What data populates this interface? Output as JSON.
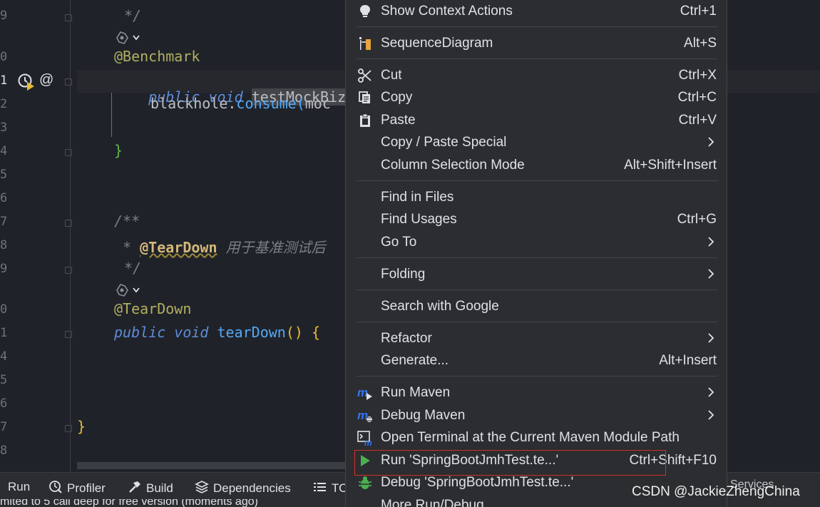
{
  "editor": {
    "line_numbers": [
      "9",
      "0",
      "1",
      "2",
      "3",
      "4",
      "5",
      "6",
      "7",
      "8",
      "9",
      "0",
      "1",
      "4",
      "5",
      "6",
      "7",
      "8"
    ],
    "code": {
      "comment_close_1": "*/",
      "ann_benchmark": "@Benchmark",
      "kw_public": "public",
      "kw_void": "void",
      "method_selected": "testMockBizSe",
      "blackhole": "blackhole.",
      "consume": "consume(",
      "moc": "moc",
      "close_brace_green": "}",
      "comment_open": "/**",
      "comment_star": " * ",
      "teardown_tag": "@TearDown",
      "teardown_desc": " 用于基准测试后",
      "comment_close_2": "*/",
      "ann_teardown": "@TearDown",
      "kw_public2": "public",
      "kw_void2": "void",
      "method_teardown": "tearDown",
      "parens": "() {",
      "class_close": "}"
    }
  },
  "context_menu": {
    "items": [
      {
        "label": "Show Context Actions",
        "shortcut": "Ctrl+1",
        "icon": "bulb-icon"
      },
      {
        "label": "SequenceDiagram",
        "shortcut": "Alt+S",
        "icon": "sequence-diagram-icon"
      },
      {
        "label": "Cut",
        "shortcut": "Ctrl+X",
        "icon": "scissors-icon"
      },
      {
        "label": "Copy",
        "shortcut": "Ctrl+C",
        "icon": "copy-icon"
      },
      {
        "label": "Paste",
        "shortcut": "Ctrl+V",
        "icon": "paste-icon"
      },
      {
        "label": "Copy / Paste Special",
        "shortcut": "",
        "icon": ""
      },
      {
        "label": "Column Selection Mode",
        "shortcut": "Alt+Shift+Insert",
        "icon": ""
      },
      {
        "label": "Find in Files",
        "shortcut": "",
        "icon": ""
      },
      {
        "label": "Find Usages",
        "shortcut": "Ctrl+G",
        "icon": ""
      },
      {
        "label": "Go To",
        "shortcut": "",
        "icon": ""
      },
      {
        "label": "Folding",
        "shortcut": "",
        "icon": ""
      },
      {
        "label": "Search with Google",
        "shortcut": "",
        "icon": ""
      },
      {
        "label": "Refactor",
        "shortcut": "",
        "icon": ""
      },
      {
        "label": "Generate...",
        "shortcut": "Alt+Insert",
        "icon": ""
      },
      {
        "label": "Run Maven",
        "shortcut": "",
        "icon": "maven-run-icon"
      },
      {
        "label": "Debug Maven",
        "shortcut": "",
        "icon": "maven-debug-icon"
      },
      {
        "label": "Open Terminal at the Current Maven Module Path",
        "shortcut": "",
        "icon": "terminal-maven-icon"
      },
      {
        "label": "Run 'SpringBootJmhTest.te...'",
        "shortcut": "Ctrl+Shift+F10",
        "icon": "run-icon"
      },
      {
        "label": "Debug 'SpringBootJmhTest.te...'",
        "shortcut": "",
        "icon": "debug-icon"
      },
      {
        "label": "More Run/Debug",
        "shortcut": "",
        "icon": ""
      }
    ]
  },
  "toolbar": {
    "run": "Run",
    "profiler": "Profiler",
    "build": "Build",
    "dependencies": "Dependencies",
    "todo": "TO",
    "services": "Services"
  },
  "status": {
    "message": "mited to 5 call deep for free version (moments ago)"
  },
  "watermark": "CSDN @JackieZhengChina",
  "colors": {
    "editor_bg": "#1f2329",
    "menu_bg": "#2b2d30",
    "highlight_border": "#d32f2f",
    "keyword": "#5f8cd8",
    "run_green": "#4caf50"
  }
}
